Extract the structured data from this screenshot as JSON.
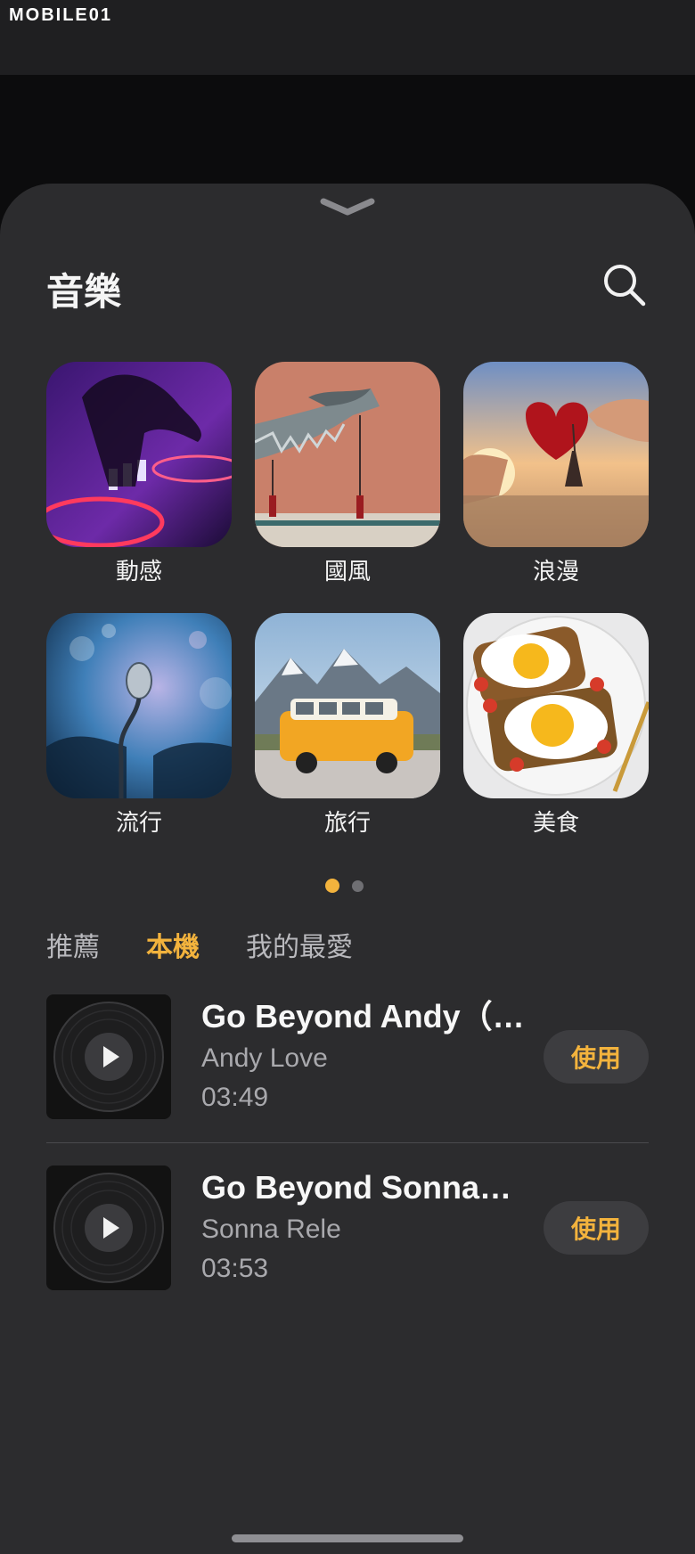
{
  "watermark": "MOBILE01",
  "sheet": {
    "title": "音樂",
    "search_icon": "search-icon",
    "collapse_icon": "chevron-down-icon"
  },
  "categories": [
    {
      "label": "動感",
      "image": "dj-turntable"
    },
    {
      "label": "國風",
      "image": "chinese-eave-dragon"
    },
    {
      "label": "浪漫",
      "image": "heart-eiffel-tower"
    },
    {
      "label": "流行",
      "image": "microphone-concert"
    },
    {
      "label": "旅行",
      "image": "camper-van-mountains"
    },
    {
      "label": "美食",
      "image": "fried-eggs-toast"
    }
  ],
  "pager": {
    "pages": 2,
    "current": 1
  },
  "tabs": [
    {
      "label": "推薦",
      "active": false
    },
    {
      "label": "本機",
      "active": true
    },
    {
      "label": "我的最愛",
      "active": false
    }
  ],
  "songs": [
    {
      "title": "Go Beyond Andy（H...",
      "artist": "Andy Love",
      "duration": "03:49",
      "action": "使用"
    },
    {
      "title": "Go Beyond Sonna（...",
      "artist": "Sonna Rele",
      "duration": "03:53",
      "action": "使用"
    }
  ],
  "colors": {
    "accent": "#f3b33d",
    "sheet_bg": "#2c2c2e",
    "text_primary": "#f7f7f7",
    "text_secondary": "#a9a9ad"
  }
}
